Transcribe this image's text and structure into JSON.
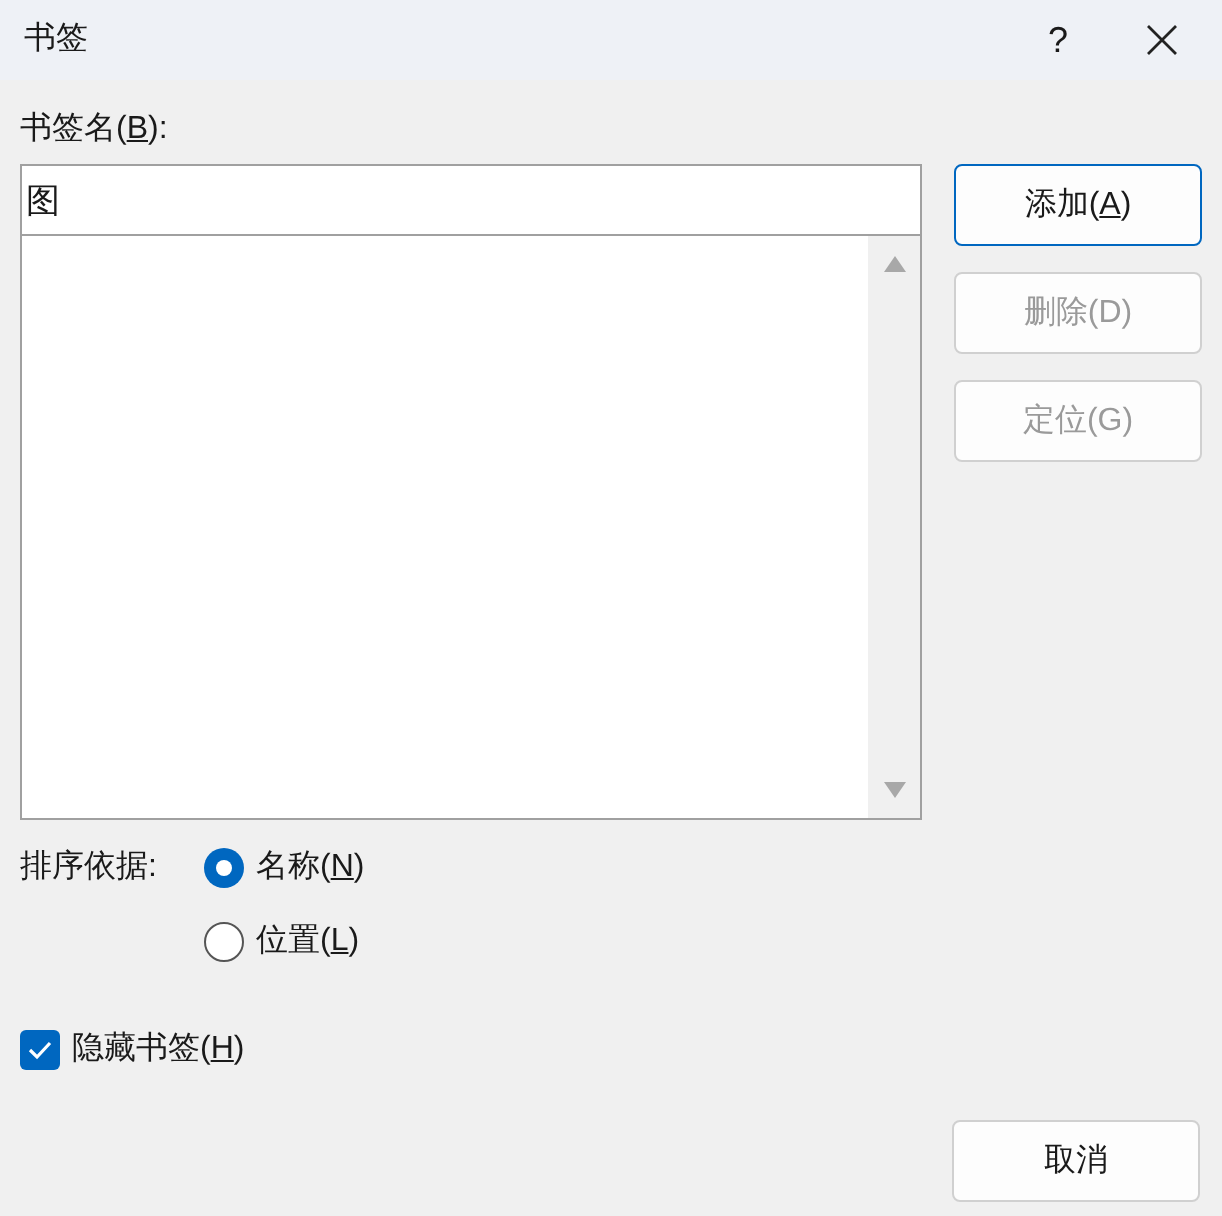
{
  "window": {
    "title": "书签",
    "help": "?"
  },
  "name_field": {
    "label_parts": [
      "书签名(",
      "B",
      "):"
    ],
    "value": "图"
  },
  "buttons": [
    {
      "label_parts": [
        "添加(",
        "A",
        ")"
      ],
      "disabled": false,
      "default": true
    },
    {
      "label_parts": [
        "删除(D)"
      ],
      "disabled": true,
      "default": false
    },
    {
      "label_parts": [
        "定位(G)"
      ],
      "disabled": true,
      "default": false
    }
  ],
  "sort": {
    "label": "排序依据:",
    "options": [
      {
        "label_parts": [
          "名称(",
          "N",
          ")"
        ],
        "selected": true
      },
      {
        "label_parts": [
          "位置(",
          "L",
          ")"
        ],
        "selected": false
      }
    ]
  },
  "hidden_bookmarks": {
    "label_parts": [
      "隐藏书签(",
      "H",
      ")"
    ],
    "checked": true
  },
  "cancel_button": {
    "label": "取消"
  }
}
